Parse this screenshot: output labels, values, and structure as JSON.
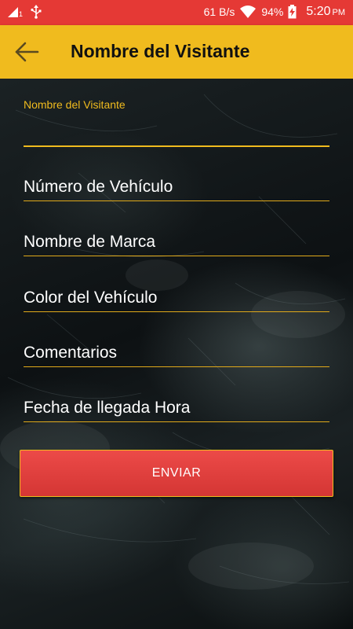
{
  "status_bar": {
    "sim_label": "1",
    "network_speed": "61 B/s",
    "battery": "94%",
    "time": "5:20",
    "ampm": "PM",
    "icons": [
      "signal-icon",
      "usb-icon",
      "wifi-icon",
      "battery-charging-icon"
    ]
  },
  "app_bar": {
    "title": "Nombre del Visitante",
    "back_icon": "arrow-left-icon"
  },
  "form": {
    "visitor_name": {
      "floating_label": "Nombre del Visitante",
      "value": ""
    },
    "vehicle_number": {
      "placeholder": "Número de Vehículo"
    },
    "brand_name": {
      "placeholder": "Nombre de Marca"
    },
    "vehicle_color": {
      "placeholder": "Color del Vehículo"
    },
    "comments": {
      "placeholder": "Comentarios"
    },
    "arrival_datetime": {
      "placeholder": "Fecha de llegada Hora"
    },
    "submit_label": "ENVIAR"
  },
  "colors": {
    "status_bar": "#e53935",
    "app_bar": "#f0bb1e",
    "accent": "#f0bb1e",
    "button": "#e0403e"
  }
}
